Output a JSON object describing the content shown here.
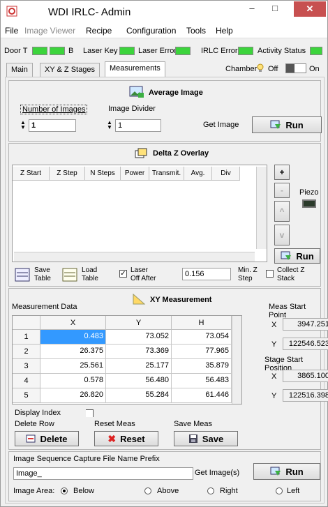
{
  "window": {
    "title": "WDI IRLC- Admin",
    "min": "–",
    "max": "□",
    "close": "✕"
  },
  "menu": [
    "File",
    "Image Viewer",
    "Recipe",
    "Configuration",
    "Tools",
    "Help"
  ],
  "status": {
    "door": "Door T",
    "door_b": "B",
    "laser_key": "Laser Key",
    "laser_error": "Laser Error",
    "irlc_error": "IRLC Error",
    "activity": "Activity Status"
  },
  "tabs": [
    "Main",
    "XY & Z Stages",
    "Measurements"
  ],
  "chamber": {
    "label": "Chamber",
    "off": "Off",
    "on": "On"
  },
  "average": {
    "title": "Average Image",
    "num_label": "Number of Images",
    "num_value": "1",
    "div_label": "Image Divider",
    "div_value": "1",
    "get": "Get Image",
    "run": "Run"
  },
  "delta": {
    "title": "Delta Z Overlay",
    "cols": [
      "Z Start",
      "Z Step",
      "N Steps",
      "Power",
      "Transmit.",
      "Avg.",
      "Div"
    ],
    "plus": "+",
    "minus": "-",
    "up": "^",
    "down": "v",
    "piezo": "Piezo",
    "run": "Run",
    "save": [
      "Save",
      "Table"
    ],
    "load": [
      "Load",
      "Table"
    ],
    "laser_off": [
      "Laser",
      "Off After"
    ],
    "value": "0.156",
    "minz": [
      "Min. Z",
      "Step"
    ],
    "collect": [
      "Collect Z",
      "Stack"
    ]
  },
  "xy": {
    "title": "XY Measurement",
    "data_label": "Measurement Data",
    "cols": [
      "X",
      "Y",
      "H"
    ],
    "rows": [
      [
        "1",
        "0.483",
        "73.052",
        "73.054"
      ],
      [
        "2",
        "26.375",
        "73.369",
        "77.965"
      ],
      [
        "3",
        "25.561",
        "25.177",
        "35.879"
      ],
      [
        "4",
        "0.578",
        "56.480",
        "56.483"
      ],
      [
        "5",
        "26.820",
        "55.284",
        "61.446"
      ]
    ],
    "meas_start": "Meas Start Point",
    "mx_label": "X",
    "mx": "3947.251",
    "my_label": "Y",
    "my": "122546.523",
    "stage_start": "Stage Start Position",
    "sx_label": "X",
    "sx": "3865.100",
    "sy_label": "Y",
    "sy": "122516.398",
    "display_index": "Display Index",
    "delete_row": "Delete Row",
    "reset_meas": "Reset Meas",
    "save_meas": "Save Meas",
    "delete": "Delete",
    "reset": "Reset",
    "save": "Save"
  },
  "seq": {
    "label": "Image Sequence Capture File Name Prefix",
    "value": "Image_",
    "get": "Get Image(s)",
    "run": "Run",
    "area": "Image Area:",
    "opts": [
      "Below",
      "Above",
      "Right",
      "Left"
    ]
  }
}
